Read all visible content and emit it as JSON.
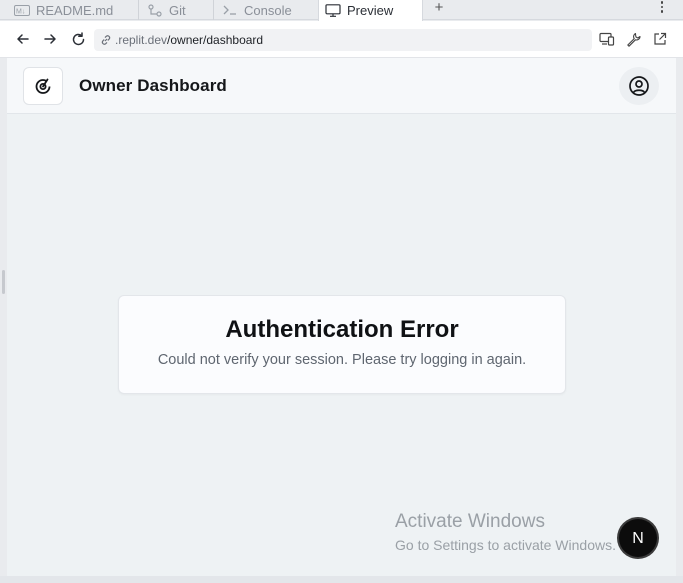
{
  "tabs": [
    {
      "label": "README.md",
      "icon": "markdown-icon",
      "active": false
    },
    {
      "label": "Git",
      "icon": "git-branch-icon",
      "active": false
    },
    {
      "label": "Console",
      "icon": "terminal-icon",
      "active": false
    },
    {
      "label": "Preview",
      "icon": "monitor-icon",
      "active": true
    }
  ],
  "new_tab_label": "+",
  "address": {
    "host": ".replit.dev",
    "path": "/owner/dashboard"
  },
  "app": {
    "title": "Owner Dashboard"
  },
  "error": {
    "title": "Authentication Error",
    "message": "Could not verify your session. Please try logging in again."
  },
  "watermark": {
    "line1": "Activate Windows",
    "line2": "Go to Settings to activate Windows."
  },
  "badge_letter": "N",
  "colors": {
    "accent_dark": "#0c0c0c",
    "viewport_bg": "#eef2f4",
    "muted_text": "#5f6670"
  }
}
